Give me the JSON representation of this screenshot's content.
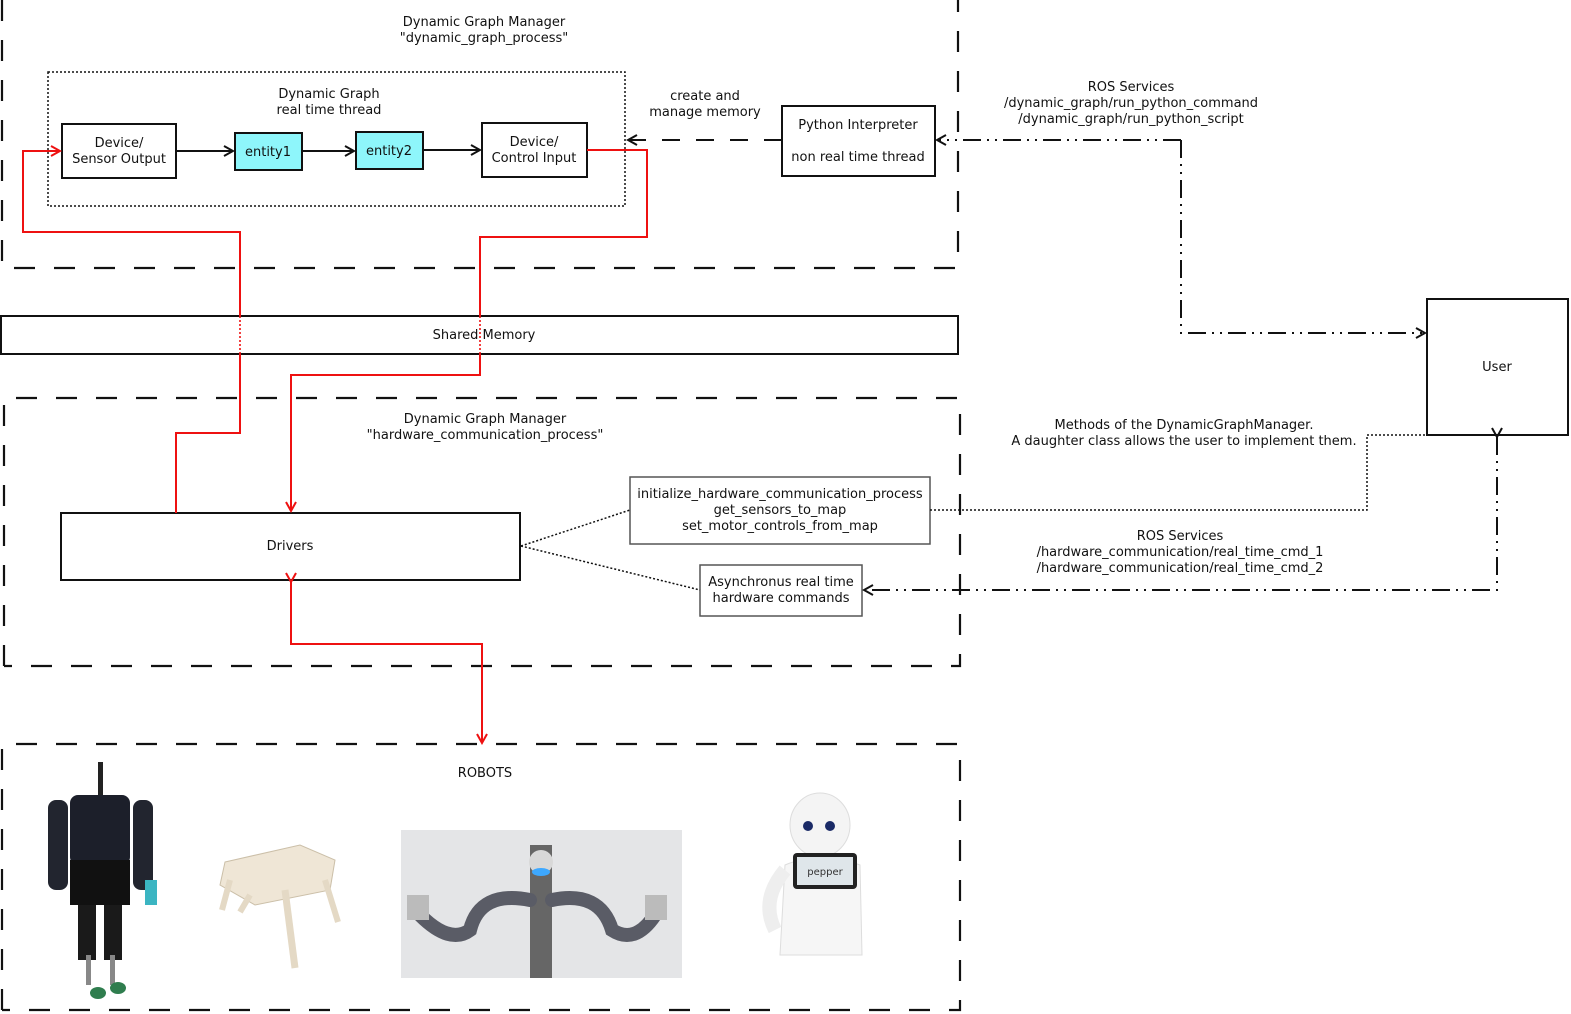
{
  "process_top": {
    "title_line1": "Dynamic Graph Manager",
    "title_line2": "\"dynamic_graph_process\"",
    "rt_thread_line1": "Dynamic Graph",
    "rt_thread_line2": "real time thread",
    "device_sensor_line1": "Device/",
    "device_sensor_line2": "Sensor Output",
    "entity1": "entity1",
    "entity2": "entity2",
    "device_control_line1": "Device/",
    "device_control_line2": "Control Input",
    "memory_label_line1": "create and",
    "memory_label_line2": "manage memory",
    "python_line1": "Python Interpreter",
    "python_line2": "non real time thread"
  },
  "ros_top": {
    "line1": "ROS Services",
    "line2": "/dynamic_graph/run_python_command",
    "line3": "/dynamic_graph/run_python_script"
  },
  "shared_memory": "Shared Memory",
  "user": "User",
  "process_hw": {
    "title_line1": "Dynamic Graph Manager",
    "title_line2": "\"hardware_communication_process\"",
    "drivers": "Drivers",
    "methods_line1": "initialize_hardware_communication_process",
    "methods_line2": "get_sensors_to_map",
    "methods_line3": "set_motor_controls_from_map",
    "async_line1": "Asynchronus real time",
    "async_line2": "hardware commands"
  },
  "methods_note": {
    "line1": "Methods of the DynamicGraphManager.",
    "line2": "A daughter class allows the user to implement them."
  },
  "ros_hw": {
    "line1": "ROS Services",
    "line2": "/hardware_communication/real_time_cmd_1",
    "line3": "/hardware_communication/real_time_cmd_2"
  },
  "robots": {
    "title": "ROBOTS",
    "items": [
      "humanoid-robot",
      "quadruped-robot",
      "dual-arm-robot",
      "pepper-robot"
    ],
    "pepper_screen": "pepper"
  },
  "colors": {
    "data_flow": "#ee1111",
    "entity_fill": "#8ef6fb"
  }
}
